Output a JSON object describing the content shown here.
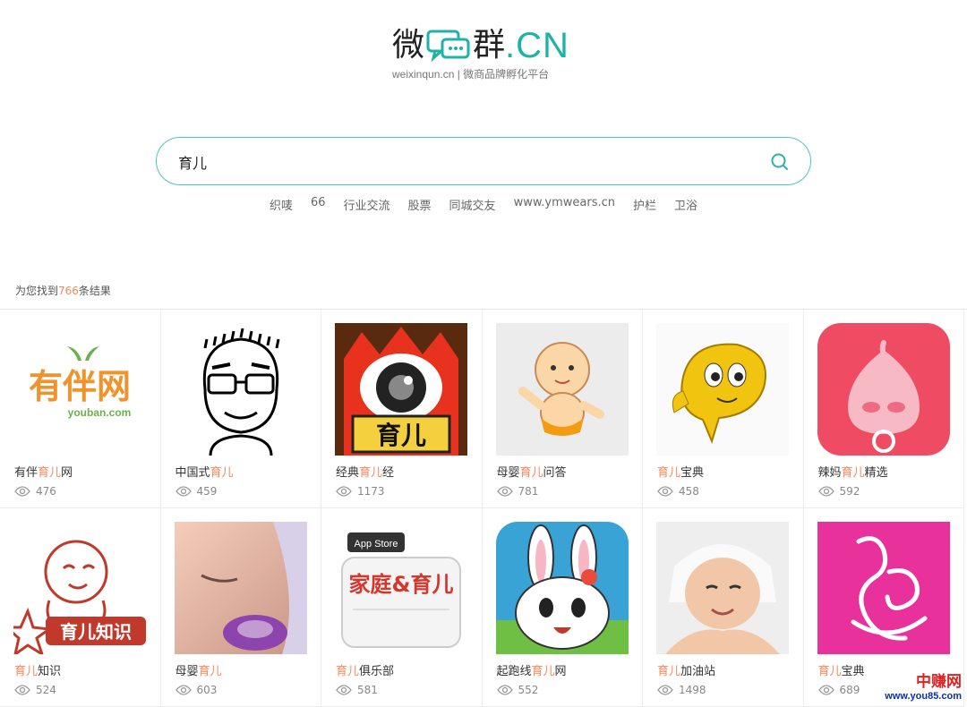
{
  "brand": {
    "char1": "微",
    "char2": "群",
    "suffix": ".CN",
    "tagline": "weixinqun.cn | 微商品牌孵化平台",
    "accent_color": "#1fb3a8"
  },
  "search": {
    "value": "育儿",
    "icon": "search-icon"
  },
  "hot_tags": [
    "织唛",
    "66",
    "行业交流",
    "股票",
    "同城交友",
    "www.ymwears.cn",
    "护栏",
    "卫浴"
  ],
  "results": {
    "prefix": "为您找到",
    "count": "766",
    "suffix": "条结果"
  },
  "cards": [
    {
      "pre": "有伴",
      "hl": "育儿",
      "post": "网",
      "views": "476",
      "thumb": "youban-logo",
      "logo_text": "有伴网",
      "logo_sub": "youban.com"
    },
    {
      "pre": "中国式",
      "hl": "育儿",
      "post": "",
      "views": "459",
      "thumb": "cartoon-man"
    },
    {
      "pre": "经典",
      "hl": "育儿",
      "post": "经",
      "views": "1173",
      "thumb": "eye-mascot",
      "logo_text": "育儿"
    },
    {
      "pre": "母婴",
      "hl": "育儿",
      "post": "问答",
      "views": "781",
      "thumb": "baby-cartoon"
    },
    {
      "pre": "",
      "hl": "育儿",
      "post": "宝典",
      "views": "458",
      "thumb": "yellow-fish"
    },
    {
      "pre": "辣妈",
      "hl": "育儿",
      "post": "精选",
      "views": "592",
      "thumb": "pacifier-icon"
    },
    {
      "pre": "",
      "hl": "育儿",
      "post": "知识",
      "views": "524",
      "thumb": "baby-sketch",
      "logo_text": "育儿知识"
    },
    {
      "pre": "母婴",
      "hl": "育儿",
      "post": "",
      "views": "603",
      "thumb": "baby-pacifier-photo"
    },
    {
      "pre": "",
      "hl": "育儿",
      "post": "俱乐部",
      "views": "581",
      "thumb": "family-parenting-app",
      "logo_text": "家庭&育儿",
      "logo_sub": "App Store"
    },
    {
      "pre": "起跑线",
      "hl": "育儿",
      "post": "网",
      "views": "552",
      "thumb": "rabbit-cartoon"
    },
    {
      "pre": "",
      "hl": "育儿",
      "post": "加油站",
      "views": "1498",
      "thumb": "baby-photo"
    },
    {
      "pre": "",
      "hl": "育儿",
      "post": "宝典",
      "views": "689",
      "thumb": "mother-silhouette"
    }
  ],
  "watermark": {
    "cn": "中赚网",
    "url": "www.you85.com"
  }
}
